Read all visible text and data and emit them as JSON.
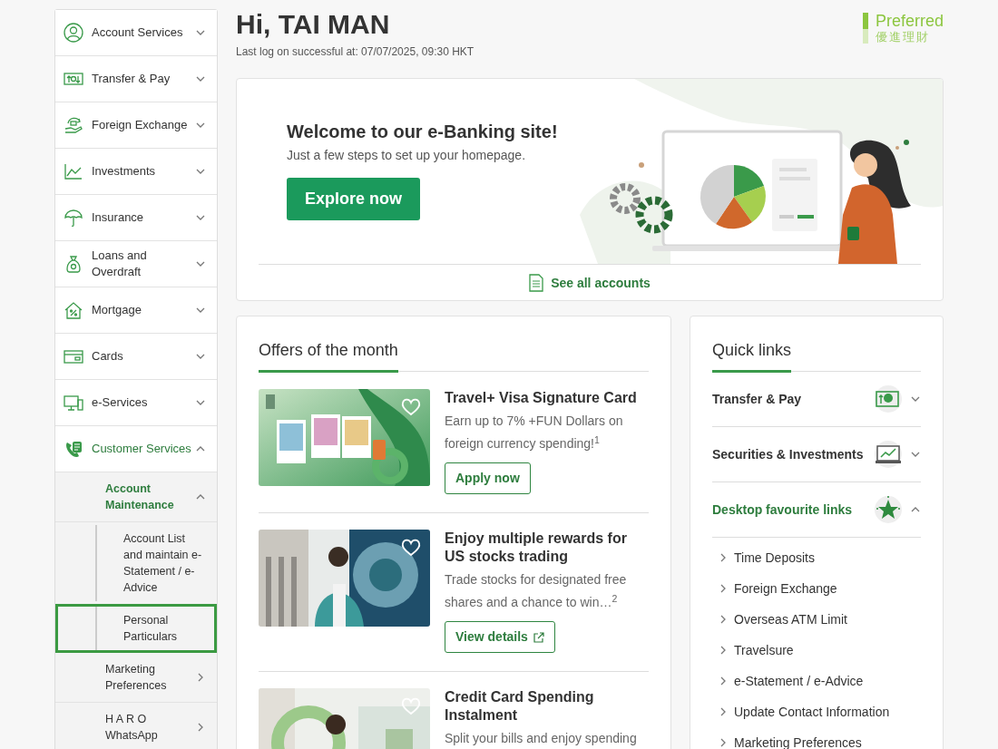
{
  "header": {
    "greeting": "Hi, TAI MAN",
    "last_logon": "Last log on successful at: 07/07/2025, 09:30 HKT",
    "tier": {
      "name": "Preferred",
      "name_local": "優進理財"
    }
  },
  "sidebar": {
    "items": [
      {
        "label": "Account Services",
        "expanded": false
      },
      {
        "label": "Transfer & Pay",
        "expanded": false
      },
      {
        "label": "Foreign Exchange",
        "expanded": false
      },
      {
        "label": "Investments",
        "expanded": false
      },
      {
        "label": "Insurance",
        "expanded": false
      },
      {
        "label": "Loans and Overdraft",
        "expanded": false
      },
      {
        "label": "Mortgage",
        "expanded": false
      },
      {
        "label": "Cards",
        "expanded": false
      },
      {
        "label": "e-Services",
        "expanded": false
      },
      {
        "label": "Customer Services",
        "expanded": true,
        "children": [
          {
            "label": "Account Maintenance",
            "expanded": true,
            "children": [
              {
                "label": "Account List and maintain e-Statement / e-Advice",
                "selected": false
              },
              {
                "label": "Personal Particulars",
                "selected": true
              }
            ]
          },
          {
            "label": "Marketing Preferences",
            "expanded": false
          },
          {
            "label": "H A R O WhatsApp",
            "expanded": false
          }
        ]
      }
    ]
  },
  "welcome": {
    "title": "Welcome to our e-Banking site!",
    "subtitle": "Just a few steps to set up your homepage.",
    "button": "Explore now",
    "link": "See all accounts"
  },
  "offers": {
    "title": "Offers of the month",
    "items": [
      {
        "title": "Travel+ Visa Signature Card",
        "description": "Earn up to 7% +FUN Dollars on foreign currency spending!$^{1}$",
        "button": "Apply now",
        "external": false,
        "favourite": false
      },
      {
        "title": "Enjoy multiple rewards for US stocks trading",
        "description": "Trade stocks for designated free shares and a chance to win…$^{2}$",
        "button": "View details",
        "external": true,
        "favourite": false
      },
      {
        "title": "Credit Card Spending Instalment",
        "description": "Split your bills and enjoy spending",
        "favourite": false
      }
    ]
  },
  "quick_links": {
    "title": "Quick links",
    "groups": [
      {
        "label": "Transfer & Pay",
        "expanded": false
      },
      {
        "label": "Securities & Investments",
        "expanded": false
      },
      {
        "label": "Desktop favourite links",
        "expanded": true,
        "links": [
          "Time Deposits",
          "Foreign Exchange",
          "Overseas ATM Limit",
          "Travelsure",
          "e-Statement / e-Advice",
          "Update Contact Information",
          "Marketing Preferences"
        ]
      }
    ]
  }
}
